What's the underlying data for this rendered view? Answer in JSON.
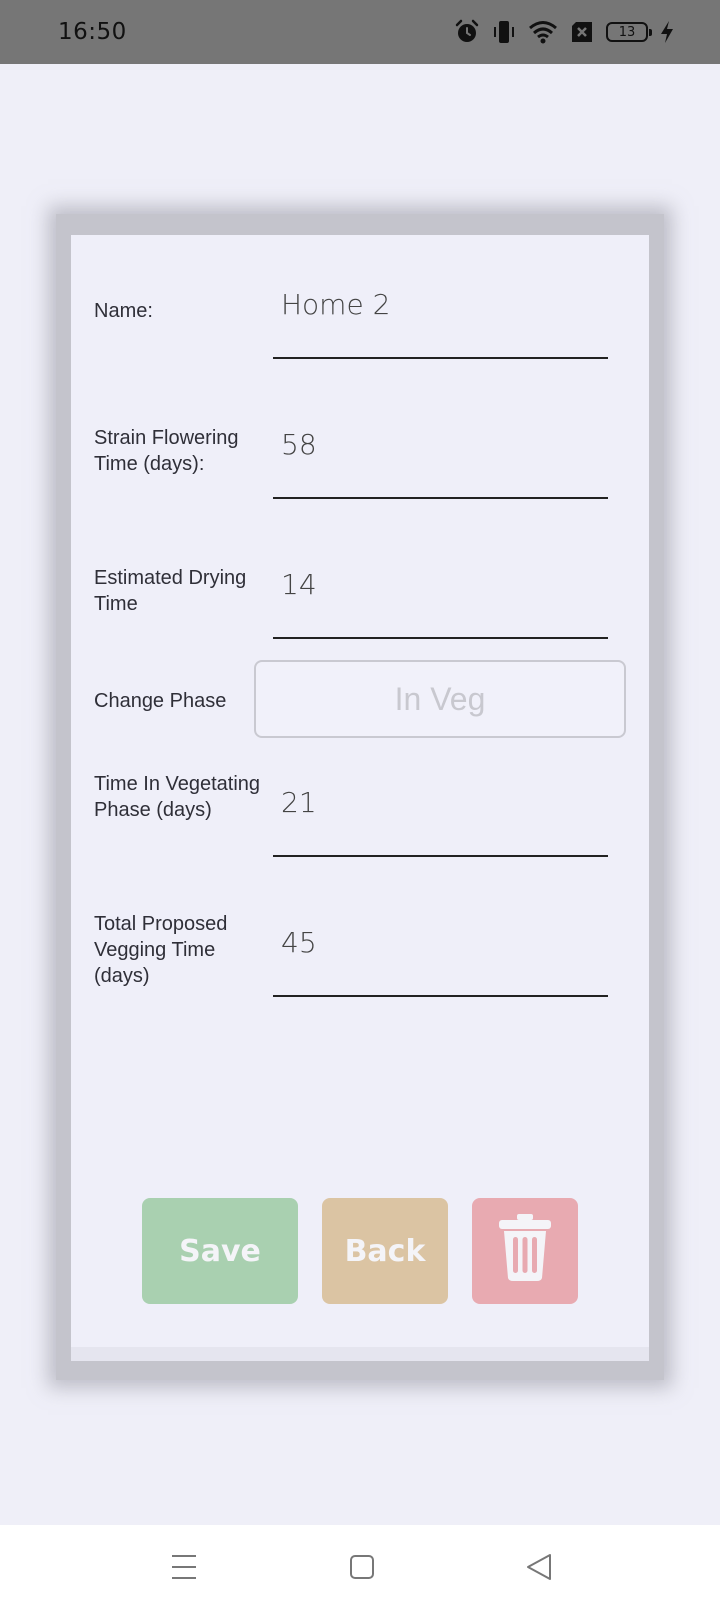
{
  "status_bar": {
    "time": "16:50",
    "battery_level": "13",
    "icons": [
      "alarm-icon",
      "vibrate-icon",
      "wifi-icon",
      "sim-off-icon",
      "battery-icon",
      "charging-icon"
    ]
  },
  "form": {
    "fields": [
      {
        "label": "Name:",
        "value": "Home 2"
      },
      {
        "label": "Strain Flowering Time (days):",
        "value": "58"
      },
      {
        "label": "Estimated Drying Time",
        "value": "14"
      },
      {
        "label": "Time In Vegetating Phase (days)",
        "value": "21"
      },
      {
        "label": "Total Proposed Vegging Time (days)",
        "value": "45"
      }
    ],
    "change_phase": {
      "label": "Change Phase",
      "button_label": "In Veg"
    }
  },
  "actions": {
    "save_label": "Save",
    "back_label": "Back",
    "delete_icon": "trash-icon"
  },
  "nav_bar": {
    "icons": [
      "menu-icon",
      "home-square-icon",
      "back-triangle-icon"
    ]
  },
  "colors": {
    "background": "#efeff8",
    "status_bar": "#767676",
    "save": "#a9d0b0",
    "back": "#dbc4a3",
    "delete": "#e8aab1"
  }
}
